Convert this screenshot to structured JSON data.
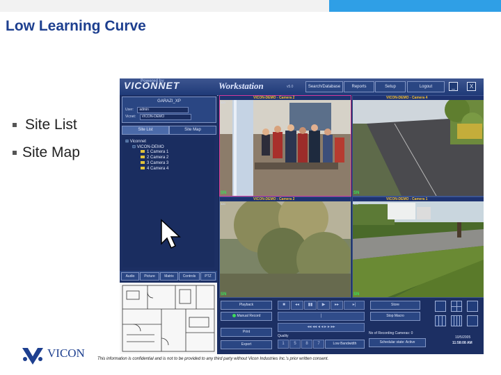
{
  "slide": {
    "title": "Low Learning Curve",
    "bullets": [
      "Site List",
      "Site Map"
    ],
    "footer": "This information is confidential and is not to be provided to any third party without Vicon Industries Inc.'s prior written consent.",
    "logo": "VICON",
    "colors": {
      "title": "#1d3f8f",
      "accent_bar": "#2f9fe6"
    }
  },
  "app": {
    "logo_text": "VICONNET",
    "logo_small": "Powered by",
    "title": "Workstation",
    "version": "v5.0",
    "menu": [
      "Search/Database",
      "Reports",
      "Setup",
      "Logout"
    ],
    "window_buttons": [
      "_",
      "X"
    ],
    "host": {
      "name": "GARAZI_XP",
      "user_label": "User:",
      "user": "admin",
      "vicnet_label": "Vicnet:",
      "vicnet": "VICON-DEMO"
    },
    "tabs": [
      "Site List",
      "Site Map"
    ],
    "tree": {
      "root": "Viconnet",
      "site": "VICON-DEMO",
      "cameras": [
        "1   Camera  1",
        "2   Camera  2",
        "3   Camera  3",
        "4   Camera  4"
      ]
    },
    "bottom_tabs": [
      "Audio",
      "Picture",
      "Matrix",
      "Controls",
      "PTZ"
    ],
    "video_cells": [
      {
        "label": "VICON-DEMO - Camera 2",
        "res": "320",
        "sn": "SN"
      },
      {
        "label": "VICON-DEMO - Camera 4",
        "res": "320",
        "sn": "SN"
      },
      {
        "label": "VICON-DEMO - Camera 2",
        "res": "320",
        "sn": "SN"
      },
      {
        "label": "VICON-DEMO - Camera 1",
        "res": "320",
        "sn": "SN"
      }
    ],
    "controls": {
      "playback": "Playback",
      "manual_record": "Manual Record",
      "print": "Print",
      "export": "Export",
      "store": "Store",
      "stop_macro": "Stop Macro",
      "quality_label": "Quality",
      "quality_values": [
        "1",
        "5",
        "8",
        "7"
      ],
      "low_bandwidth": "Low Bandwidth",
      "recording_status": "No of Recording Cameras: 0",
      "schedule_status": "Schedular state: Active",
      "date": "10/5/2005",
      "time": "11:58:08 AM"
    }
  }
}
